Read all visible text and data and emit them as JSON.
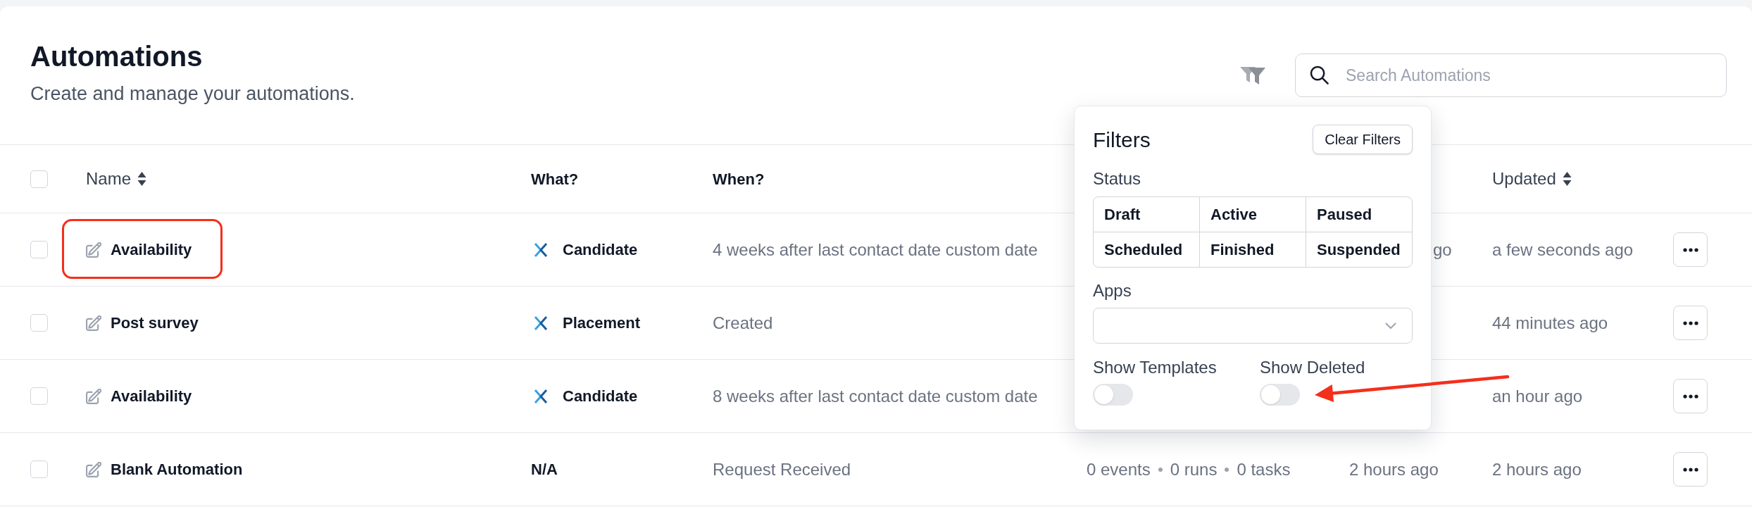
{
  "page": {
    "title": "Automations",
    "subtitle": "Create and manage your automations."
  },
  "search": {
    "placeholder": "Search Automations"
  },
  "filter_popup": {
    "title": "Filters",
    "clear_button": "Clear Filters",
    "status": {
      "label": "Status",
      "options": [
        {
          "label": "Draft",
          "selected": false
        },
        {
          "label": "Active",
          "selected": false
        },
        {
          "label": "Paused",
          "selected": false
        },
        {
          "label": "Scheduled",
          "selected": false
        },
        {
          "label": "Finished",
          "selected": false
        },
        {
          "label": "Suspended",
          "selected": false
        }
      ]
    },
    "apps": {
      "label": "Apps"
    },
    "toggles": [
      {
        "label": "Show Templates",
        "on": false,
        "annotated": false
      },
      {
        "label": "Show Deleted",
        "on": false,
        "annotated": true
      }
    ]
  },
  "table": {
    "select_all": {
      "checked": false
    },
    "columns": [
      {
        "label": "Name",
        "sortable": true
      },
      {
        "label": "What?",
        "sortable": false
      },
      {
        "label": "When?",
        "sortable": false
      },
      {
        "label": "Updated",
        "sortable": true
      }
    ],
    "rows": [
      {
        "checked": false,
        "annotated": true,
        "name": "Availability",
        "what": {
          "kind": "app",
          "label": "Candidate"
        },
        "when": "4 weeks after last contact date custom date",
        "created": {
          "text": "go",
          "covered": true
        },
        "updated": "a few seconds ago"
      },
      {
        "checked": false,
        "annotated": false,
        "name": "Post survey",
        "what": {
          "kind": "app",
          "label": "Placement"
        },
        "when": "Created",
        "updated": "44 minutes ago"
      },
      {
        "checked": false,
        "annotated": false,
        "name": "Availability",
        "what": {
          "kind": "app",
          "label": "Candidate"
        },
        "when": "8 weeks after last contact date custom date",
        "updated": "an hour ago"
      },
      {
        "checked": false,
        "annotated": false,
        "name": "Blank Automation",
        "what": {
          "kind": "none",
          "label": "N/A"
        },
        "when": "Request Received",
        "stats": [
          "0 events",
          "0 runs",
          "0 tasks"
        ],
        "created": {
          "text": "2 hours ago",
          "covered": false
        },
        "updated": "2 hours ago"
      }
    ]
  }
}
